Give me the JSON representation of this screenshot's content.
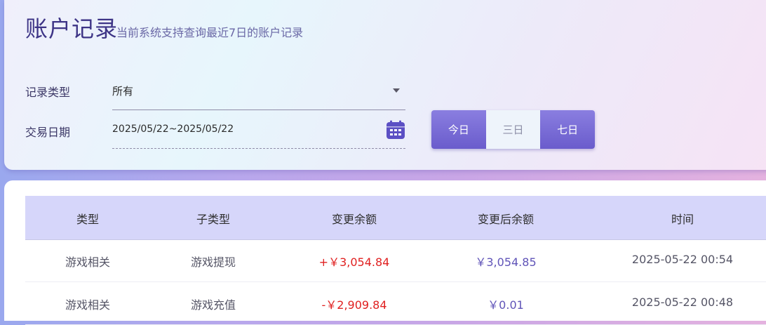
{
  "header": {
    "title": "账户记录",
    "subtitle": "当前系统支持查询最近7日的账户记录"
  },
  "filters": {
    "type_label": "记录类型",
    "type_value": "所有",
    "date_label": "交易日期",
    "date_value": "2025/05/22~2025/05/22",
    "ranges": [
      {
        "label": "今日",
        "active": true
      },
      {
        "label": "三日",
        "active": false
      },
      {
        "label": "七日",
        "active": true
      }
    ]
  },
  "colors": {
    "accent": "#6a5ccc",
    "negative_and_positive_amount": "#e02020",
    "balance": "#6054b8",
    "table_header_bg": "#d6d6fa"
  },
  "icons": {
    "date": "calendar-icon",
    "select": "chevron-down-icon"
  },
  "table": {
    "headers": [
      "类型",
      "子类型",
      "变更余额",
      "变更后余额",
      "时间"
    ],
    "rows": [
      {
        "type": "游戏相关",
        "subtype": "游戏提现",
        "change": "+￥3,054.84",
        "balance": "￥3,054.85",
        "time": "2025-05-22 00:54"
      },
      {
        "type": "游戏相关",
        "subtype": "游戏充值",
        "change": "-￥2,909.84",
        "balance": "￥0.01",
        "time": "2025-05-22 00:48"
      }
    ]
  }
}
